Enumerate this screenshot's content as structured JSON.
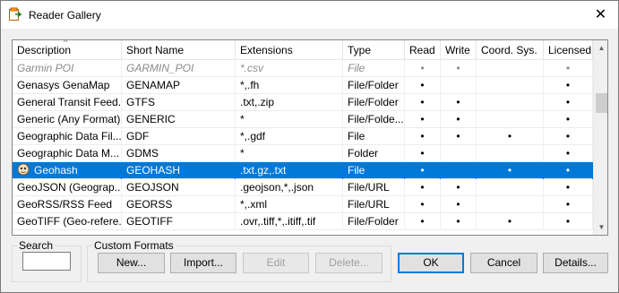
{
  "window": {
    "title": "Reader Gallery",
    "close_glyph": "✕"
  },
  "table": {
    "columns": [
      "Description",
      "Short Name",
      "Extensions",
      "Type",
      "Read",
      "Write",
      "Coord. Sys.",
      "Licensed"
    ],
    "rows": [
      {
        "description": "Garmin POI",
        "short_name": "GARMIN_POI",
        "extensions": "*.csv",
        "type": "File",
        "read": "•",
        "write": "•",
        "coord": "",
        "licensed": "•",
        "state": "disabled"
      },
      {
        "description": "Genasys GenaMap",
        "short_name": "GENAMAP",
        "extensions": "*,.fh",
        "type": "File/Folder",
        "read": "•",
        "write": "",
        "coord": "",
        "licensed": "•",
        "state": "normal"
      },
      {
        "description": "General Transit Feed...",
        "short_name": "GTFS",
        "extensions": ".txt,.zip",
        "type": "File/Folder",
        "read": "•",
        "write": "•",
        "coord": "",
        "licensed": "•",
        "state": "normal"
      },
      {
        "description": "Generic (Any Format)",
        "short_name": "GENERIC",
        "extensions": "*",
        "type": "File/Folde...",
        "read": "•",
        "write": "•",
        "coord": "",
        "licensed": "•",
        "state": "normal"
      },
      {
        "description": "Geographic Data Fil...",
        "short_name": "GDF",
        "extensions": "*,.gdf",
        "type": "File",
        "read": "•",
        "write": "•",
        "coord": "•",
        "licensed": "•",
        "state": "normal"
      },
      {
        "description": "Geographic Data M...",
        "short_name": "GDMS",
        "extensions": "*",
        "type": "Folder",
        "read": "•",
        "write": "",
        "coord": "",
        "licensed": "•",
        "state": "normal"
      },
      {
        "description": "Geohash",
        "short_name": "GEOHASH",
        "extensions": ".txt.gz,.txt",
        "type": "File",
        "read": "•",
        "write": "",
        "coord": "•",
        "licensed": "•",
        "state": "selected",
        "icon": "geohash-format-icon"
      },
      {
        "description": "GeoJSON (Geograp...",
        "short_name": "GEOJSON",
        ".extensions_note": "",
        "extensions": ".geojson,*,.json",
        "type": "File/URL",
        "read": "•",
        "write": "•",
        "coord": "",
        "licensed": "•",
        "state": "normal"
      },
      {
        "description": "GeoRSS/RSS Feed",
        "short_name": "GEORSS",
        "extensions": "*,.xml",
        "type": "File/URL",
        "read": "•",
        "write": "•",
        "coord": "",
        "licensed": "•",
        "state": "normal"
      },
      {
        "description": "GeoTIFF (Geo-refere...",
        "short_name": "GEOTIFF",
        "extensions": ".ovr,.tiff,*,.itiff,.tif",
        "type": "File/Folder",
        "read": "•",
        "write": "•",
        "coord": "•",
        "licensed": "•",
        "state": "normal"
      }
    ]
  },
  "search": {
    "label": "Search",
    "value": ""
  },
  "custom_formats": {
    "label": "Custom Formats",
    "new_label": "New...",
    "import_label": "Import...",
    "edit_label": "Edit",
    "delete_label": "Delete..."
  },
  "buttons": {
    "ok_label": "OK",
    "cancel_label": "Cancel",
    "details_label": "Details..."
  },
  "colors": {
    "selection": "#0078d7",
    "disabled_text": "#8a8a8a"
  }
}
